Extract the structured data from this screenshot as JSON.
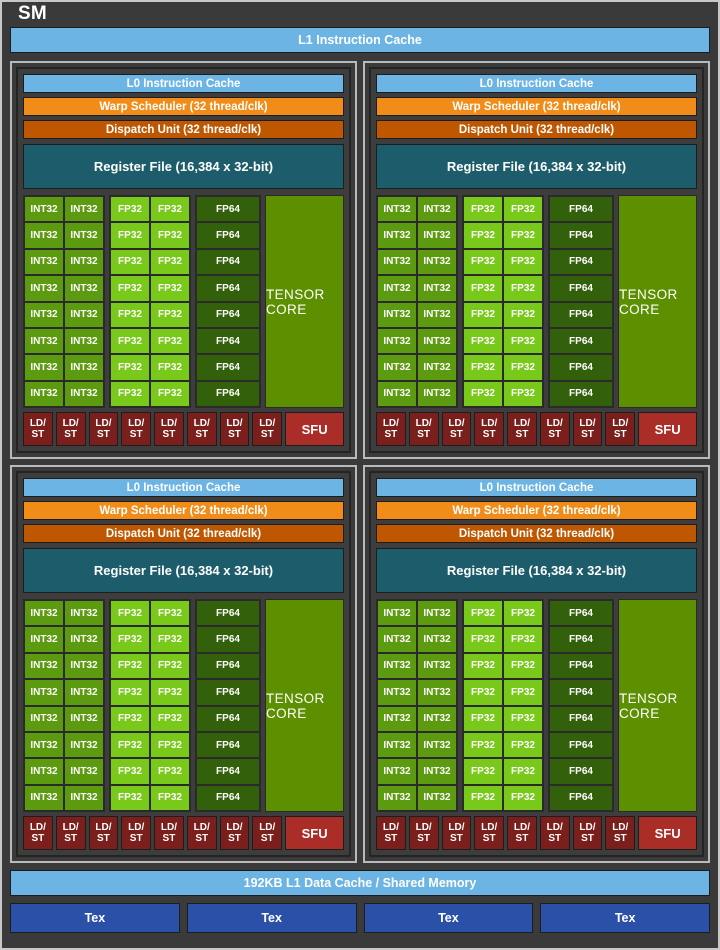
{
  "diagram": {
    "title": "SM",
    "l1_instruction_cache": "L1 Instruction Cache",
    "l1_data_cache": "192KB L1 Data Cache / Shared Memory"
  },
  "colors": {
    "background": "#3a3a3a",
    "cache_blue": "#6cb4e4",
    "warp_scheduler_orange": "#f28c18",
    "dispatch_orange": "#bf5700",
    "register_file_teal": "#1d5c6b",
    "int32_green": "#5c9a0f",
    "fp32_green": "#79c91a",
    "fp64_green": "#33610b",
    "tensor_core_green": "#5d9000",
    "ldst_maroon": "#7a1f1c",
    "sfu_red": "#aa2d28",
    "tex_blue": "#2a50a8",
    "frame_border": "#c8c8c8",
    "text": "#ffffff"
  },
  "processing_block": {
    "l0_instruction_cache": "L0 Instruction Cache",
    "warp_scheduler": "Warp Scheduler (32 thread/clk)",
    "dispatch_unit": "Dispatch Unit (32 thread/clk)",
    "register_file": "Register File (16,384 x 32-bit)",
    "tensor_core": "TENSOR CORE",
    "sfu": "SFU",
    "ldst": "LD/\nST",
    "ldst_line1": "LD/",
    "ldst_line2": "ST",
    "core_rows": 8,
    "ldst_count": 8,
    "columns": [
      {
        "type": "int32",
        "label": "INT32"
      },
      {
        "type": "int32",
        "label": "INT32"
      },
      {
        "type": "fp32",
        "label": "FP32"
      },
      {
        "type": "fp32",
        "label": "FP32"
      },
      {
        "type": "fp64",
        "label": "FP64"
      }
    ]
  },
  "quadrants": [
    {
      "id": "processing-block-0",
      "position": "top-left"
    },
    {
      "id": "processing-block-1",
      "position": "top-right"
    },
    {
      "id": "processing-block-2",
      "position": "bottom-left"
    },
    {
      "id": "processing-block-3",
      "position": "bottom-right"
    }
  ],
  "tex_units": [
    {
      "label": "Tex"
    },
    {
      "label": "Tex"
    },
    {
      "label": "Tex"
    },
    {
      "label": "Tex"
    }
  ]
}
